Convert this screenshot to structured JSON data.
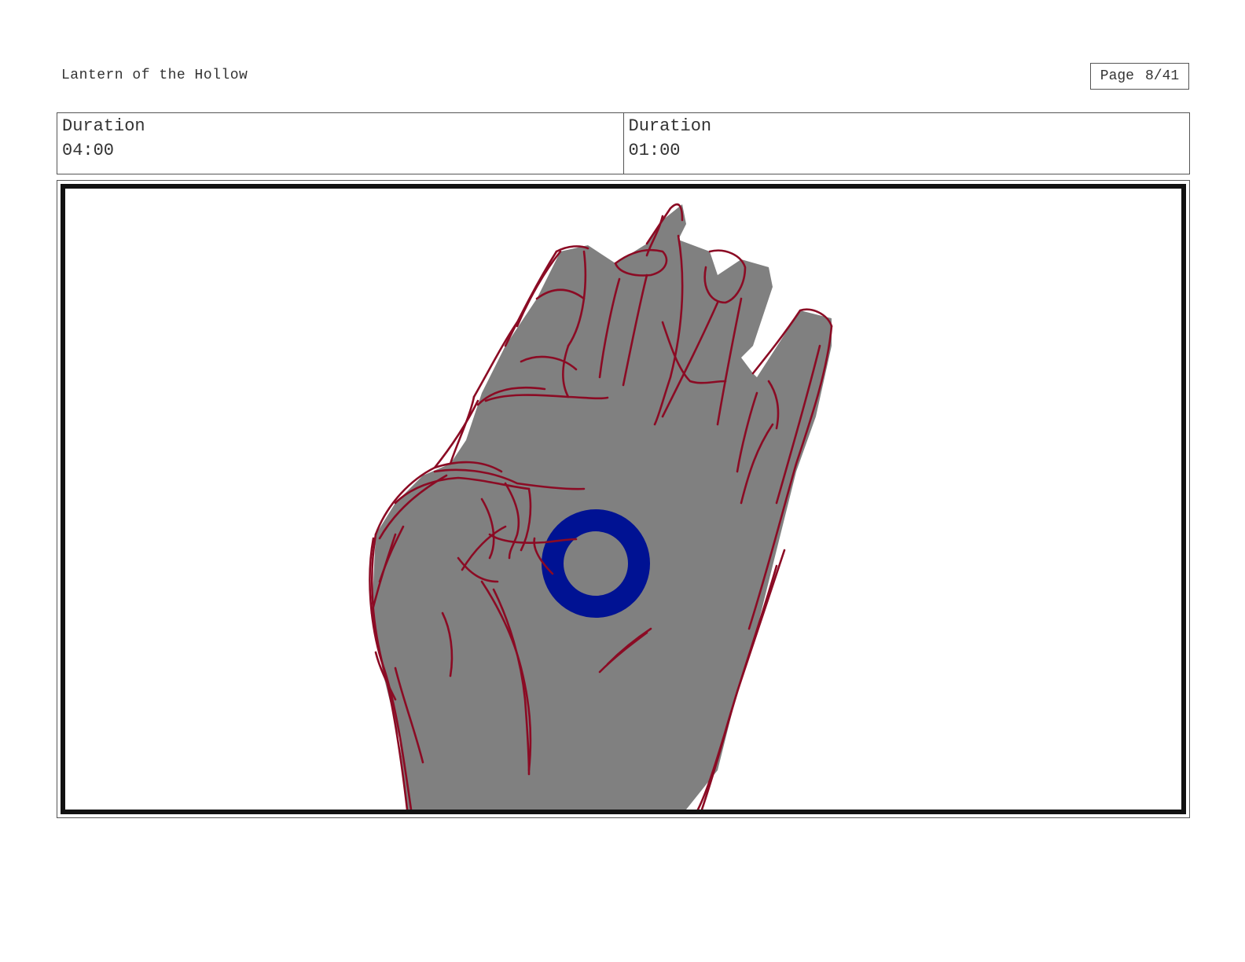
{
  "header": {
    "project_title": "Lantern of the Hollow",
    "page_label": "Page",
    "page_number": "8/41"
  },
  "info": [
    {
      "label": "Duration",
      "value": "04:00"
    },
    {
      "label": "Duration",
      "value": "01:00"
    }
  ],
  "panel": {
    "colors": {
      "hand_fill": "#808080",
      "sketch_line": "#8b0b24",
      "ring": "#001293",
      "frame": "#111111"
    }
  }
}
